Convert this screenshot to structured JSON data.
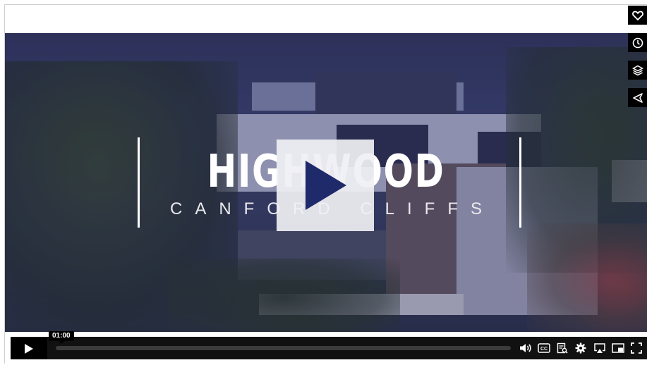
{
  "video": {
    "title": "HIGHWOOD",
    "subtitle": "CANFORD CLIFFS"
  },
  "player": {
    "current_time": "01:00",
    "progress_fraction": 0.0,
    "accent_color": "#000000"
  },
  "side_actions": [
    {
      "name": "like-button",
      "icon": "heart-icon"
    },
    {
      "name": "watch-later-button",
      "icon": "clock-icon"
    },
    {
      "name": "collections-button",
      "icon": "layers-icon"
    },
    {
      "name": "share-button",
      "icon": "paper-plane-icon"
    }
  ],
  "controls": [
    {
      "name": "volume-button",
      "icon": "volume-icon"
    },
    {
      "name": "captions-button",
      "icon": "cc-icon"
    },
    {
      "name": "transcript-button",
      "icon": "transcript-icon"
    },
    {
      "name": "settings-button",
      "icon": "gear-icon"
    },
    {
      "name": "airplay-button",
      "icon": "airplay-icon"
    },
    {
      "name": "pip-button",
      "icon": "picture-in-picture-icon"
    },
    {
      "name": "fullscreen-button",
      "icon": "fullscreen-icon"
    }
  ]
}
